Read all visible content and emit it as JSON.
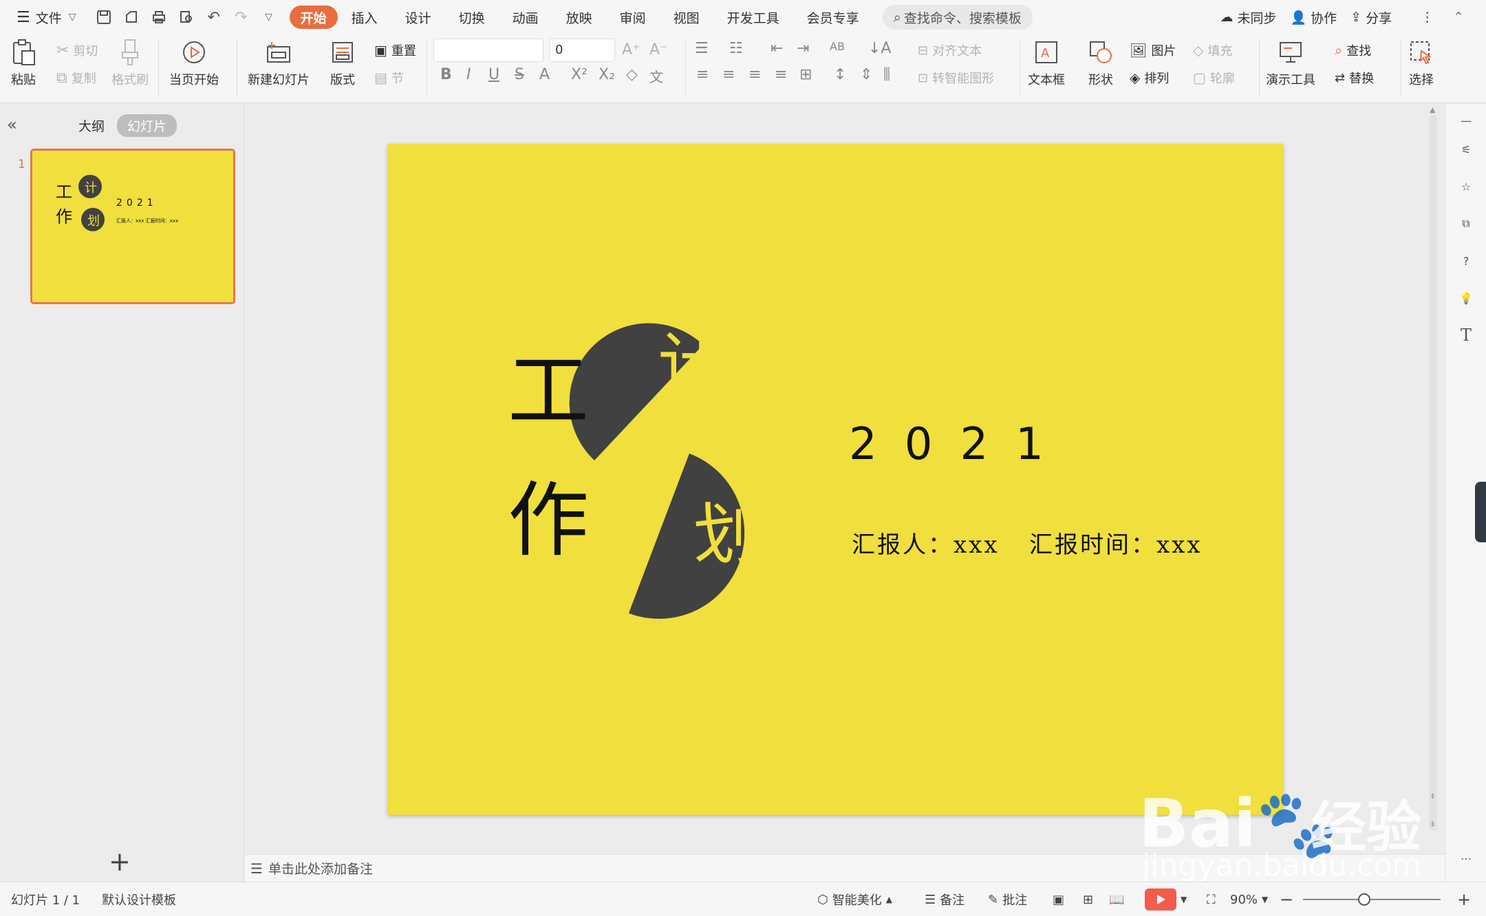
{
  "menubar": {
    "menu_label": "文件",
    "tabs": [
      "开始",
      "插入",
      "设计",
      "切换",
      "动画",
      "放映",
      "审阅",
      "视图",
      "开发工具",
      "会员专享"
    ],
    "active_tab": "开始",
    "search_placeholder": "查找命令、搜索模板",
    "sync_label": "未同步",
    "collab_label": "协作",
    "share_label": "分享"
  },
  "ribbon": {
    "paste": "粘贴",
    "cut": "剪切",
    "copy": "复制",
    "format_painter": "格式刷",
    "from_current": "当页开始",
    "new_slide": "新建幻灯片",
    "layout": "版式",
    "reset": "重置",
    "section": "节",
    "font_size": "0",
    "align_text": "对齐文本",
    "smartart": "转智能图形",
    "textbox": "文本框",
    "shape": "形状",
    "picture": "图片",
    "arrange": "排列",
    "fill": "填充",
    "outline": "轮廓",
    "present_tools": "演示工具",
    "find": "查找",
    "replace": "替换",
    "select": "选择"
  },
  "left_panel": {
    "tab_outline": "大纲",
    "tab_slides": "幻灯片",
    "slide_number": "1"
  },
  "slide": {
    "char_gong": "工",
    "char_zuo": "作",
    "char_ji": "计",
    "char_hua": "划",
    "year": "2021",
    "reporter": "汇报人：xxx",
    "report_time": "汇报时间：xxx",
    "background": "#f0df3c",
    "accent_dark": "#414141"
  },
  "notes": {
    "placeholder": "单击此处添加备注"
  },
  "statusbar": {
    "slide_count": "幻灯片 1 / 1",
    "template": "默认设计模板",
    "beautify": "智能美化",
    "notes": "备注",
    "comments": "批注",
    "zoom": "90%"
  },
  "watermark": {
    "brand": "Bai",
    "brand_tail": "经验",
    "url": "jingyan.baidu.com"
  }
}
